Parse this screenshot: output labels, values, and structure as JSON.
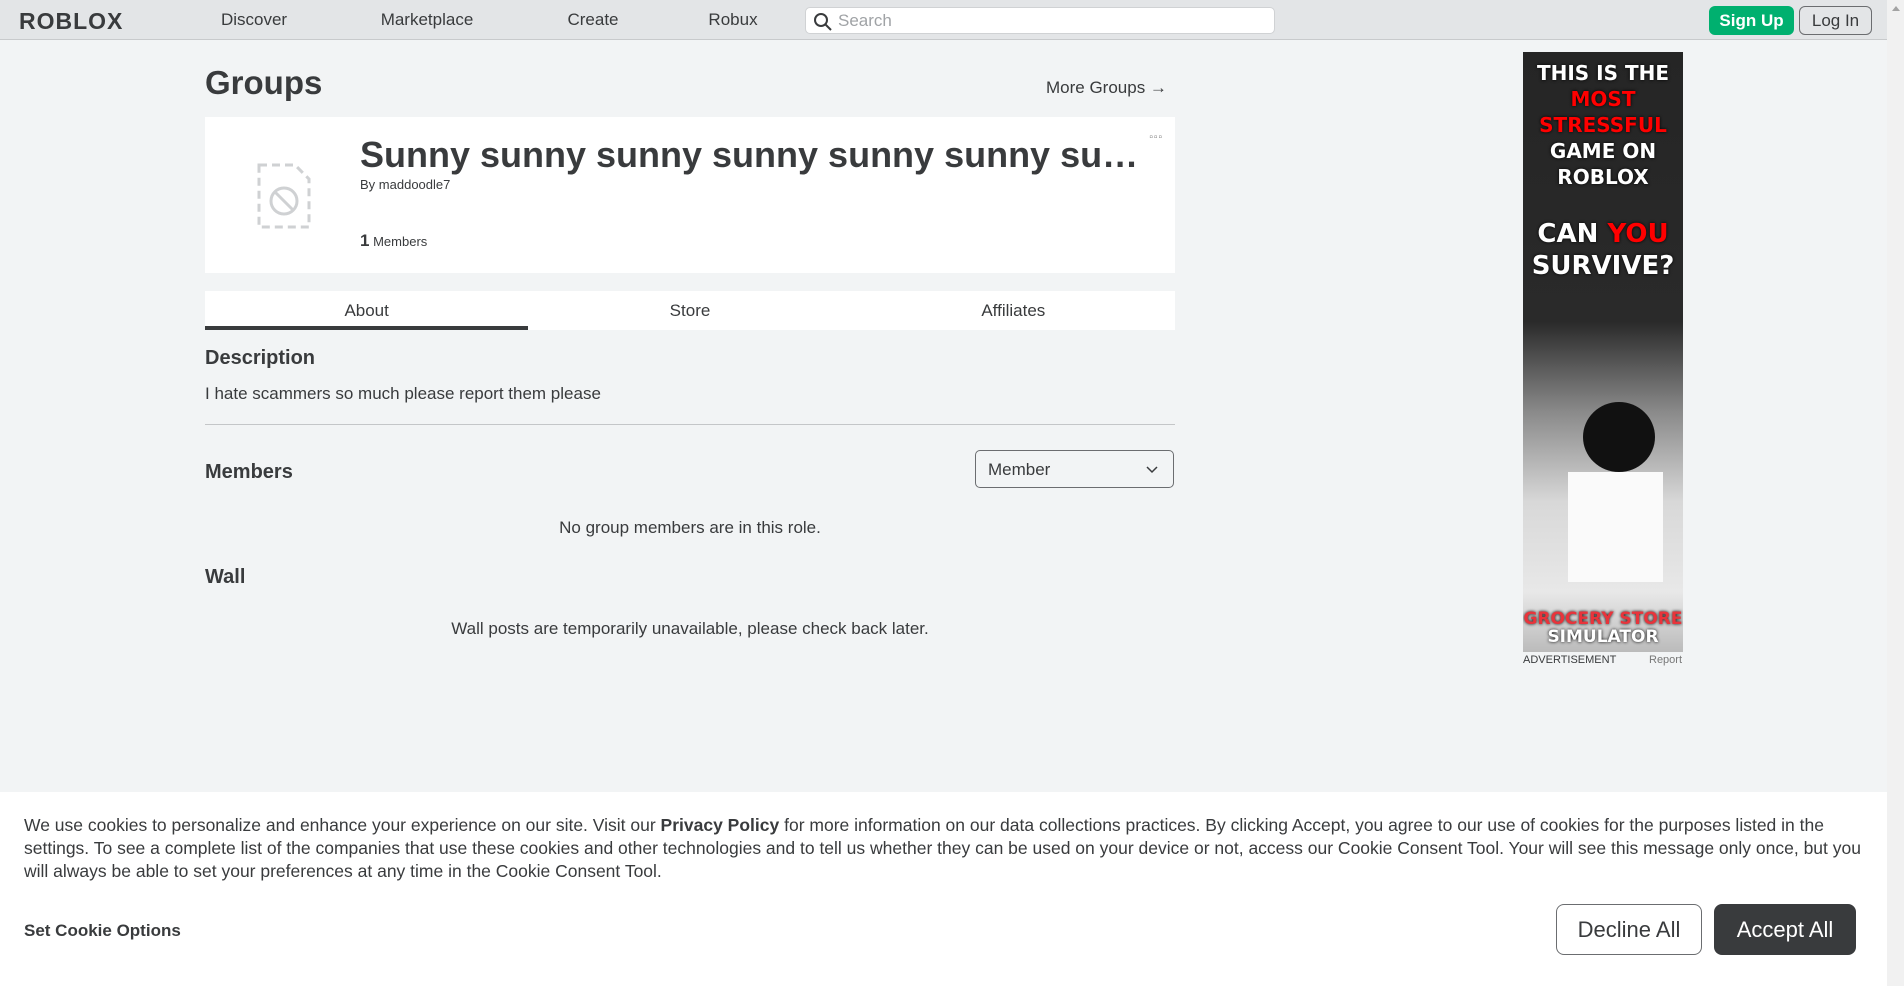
{
  "nav": {
    "logo": "ROBLOX",
    "links": [
      "Discover",
      "Marketplace",
      "Create",
      "Robux"
    ],
    "search_placeholder": "Search",
    "signup": "Sign Up",
    "login": "Log In"
  },
  "page": {
    "title": "Groups",
    "more_groups": "More Groups →"
  },
  "group": {
    "name": "Sunny sunny sunny sunny sunny sunny sunny",
    "by": "By",
    "owner": "maddoodle7",
    "member_count": "1",
    "members_label": "Members",
    "more_icon": "ellipsis-icon"
  },
  "tabs": [
    {
      "label": "About",
      "active": true
    },
    {
      "label": "Store"
    },
    {
      "label": "Affiliates"
    }
  ],
  "description": {
    "heading": "Description",
    "text": "I hate scammers so much please report them please"
  },
  "members": {
    "heading": "Members",
    "role_selected": "Member",
    "empty": "No group members are in this role."
  },
  "wall": {
    "heading": "Wall",
    "text": "Wall posts are temporarily unavailable, please check back later."
  },
  "ad": {
    "line1": "THIS IS THE",
    "line2": "MOST",
    "line3": "STRESSFUL",
    "line4": "GAME ON",
    "line5": "ROBLOX",
    "line6a": "CAN",
    "line6b": "YOU",
    "line7": "SURVIVE?",
    "game_logo1": "GROCERY STORE",
    "game_logo2": "SIMULATOR",
    "label": "ADVERTISEMENT",
    "report": "Report"
  },
  "cookie": {
    "text_before": "We use cookies to personalize and enhance your experience on our site. Visit our ",
    "link": "Privacy Policy",
    "text_after": " for more information on our data collections practices. By clicking Accept, you agree to our use of cookies for the purposes listed in the settings. To see a complete list of the companies that use these cookies and other technologies and to tell us whether they can be used on your device or not, access our Cookie Consent Tool. Your will see this message only once, but you will always be able to set your preferences at any time in the Cookie Consent Tool.",
    "set_options": "Set Cookie Options",
    "decline": "Decline All",
    "accept": "Accept All"
  },
  "colors": {
    "signup": "#00b06f",
    "accept": "#393b3d",
    "background": "#f2f4f5"
  }
}
